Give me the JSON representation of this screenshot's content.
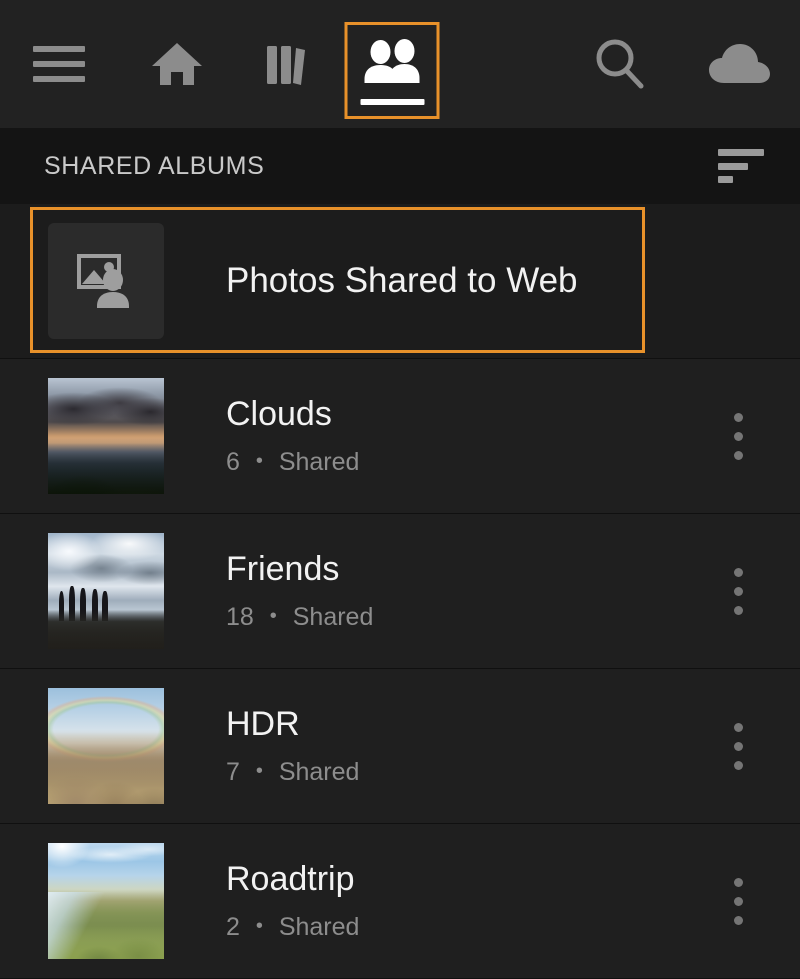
{
  "nav": {
    "items": [
      {
        "name": "menu",
        "icon": "hamburger-icon",
        "selected": false
      },
      {
        "name": "home",
        "icon": "home-icon",
        "selected": false
      },
      {
        "name": "library",
        "icon": "books-icon",
        "selected": false
      },
      {
        "name": "people",
        "icon": "people-icon",
        "selected": true
      },
      {
        "name": "search",
        "icon": "search-icon",
        "selected": false
      },
      {
        "name": "cloud",
        "icon": "cloud-icon",
        "selected": false
      }
    ]
  },
  "header": {
    "title": "SHARED ALBUMS",
    "sort_icon": "sort-icon"
  },
  "albums": [
    {
      "title": "Photos Shared to Web",
      "count": "",
      "status": "",
      "meta": "",
      "selected": true,
      "thumb": "placeholder-photo-person-icon",
      "has_menu": false
    },
    {
      "title": "Clouds",
      "count": "6",
      "status": "Shared",
      "meta": "6 • Shared",
      "selected": false,
      "thumb": "sunset-mountains-photo",
      "has_menu": true
    },
    {
      "title": "Friends",
      "count": "18",
      "status": "Shared",
      "meta": "18 • Shared",
      "selected": false,
      "thumb": "silhouettes-sky-photo",
      "has_menu": true
    },
    {
      "title": "HDR",
      "count": "7",
      "status": "Shared",
      "meta": "7 • Shared",
      "selected": false,
      "thumb": "rainbow-mountains-photo",
      "has_menu": true
    },
    {
      "title": "Roadtrip",
      "count": "2",
      "status": "Shared",
      "meta": "2 • Shared",
      "selected": false,
      "thumb": "river-valley-photo",
      "has_menu": true
    }
  ],
  "colors": {
    "accent": "#e8912a",
    "topbar_bg": "#222222",
    "header_bg": "#141414",
    "row_bg": "#1f1f1f",
    "title_text": "#f2f2f2",
    "meta_text": "#8d8d8d",
    "icon_inactive": "#8c8c8c",
    "icon_active": "#ffffff"
  }
}
